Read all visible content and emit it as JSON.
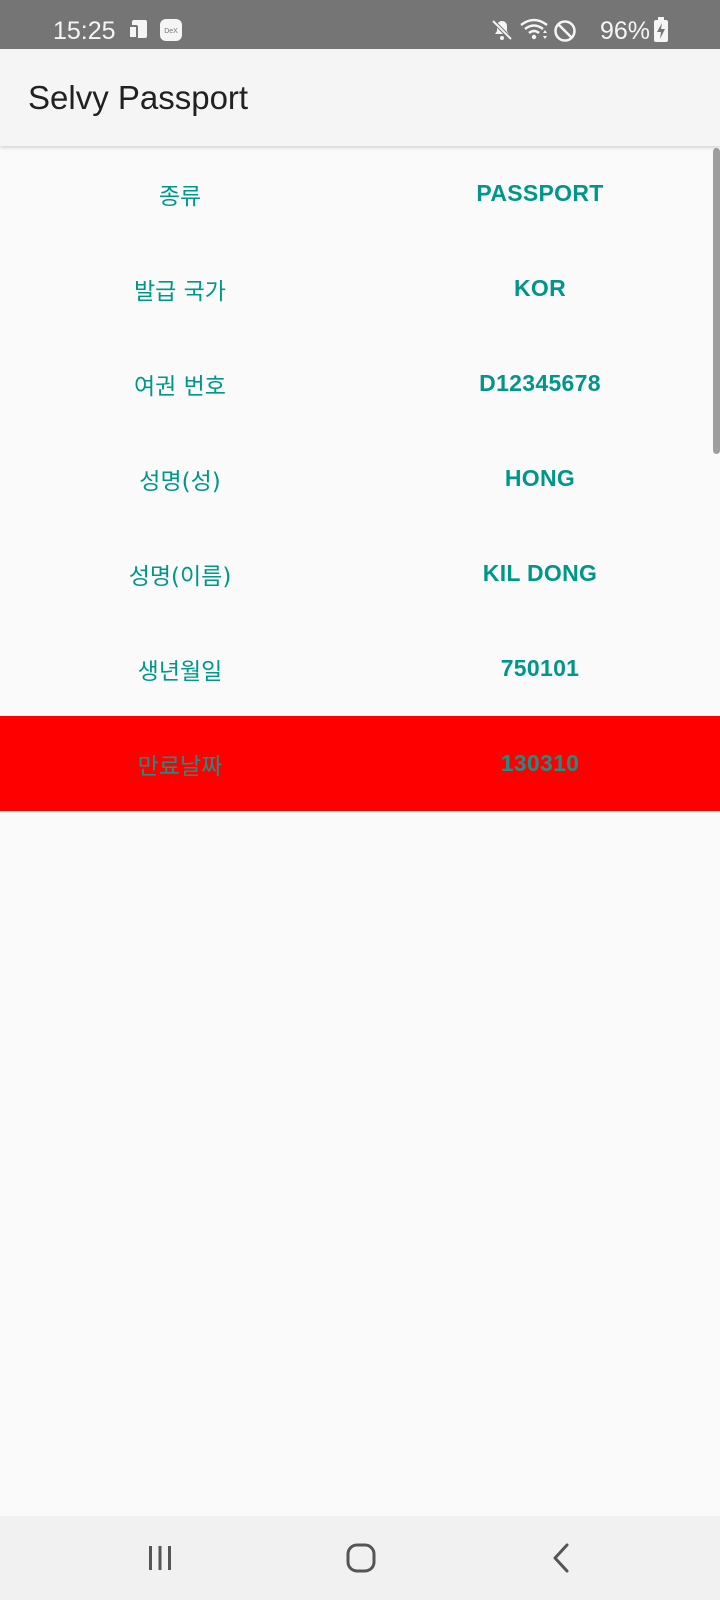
{
  "status_bar": {
    "time": "15:25",
    "battery": "96%",
    "icons": [
      "sim-icon",
      "dex-icon",
      "mute-icon",
      "wifi-icon",
      "do-not-disturb-icon",
      "battery-charging-icon"
    ],
    "dex_label": "DeX"
  },
  "app_bar": {
    "title": "Selvy Passport"
  },
  "fields": [
    {
      "label": "종류",
      "value": "PASSPORT"
    },
    {
      "label": "발급 국가",
      "value": "KOR"
    },
    {
      "label": "여권 번호",
      "value": "D12345678"
    },
    {
      "label": "성명(성)",
      "value": "HONG"
    },
    {
      "label": "성명(이름)",
      "value": "KIL DONG"
    },
    {
      "label": "생년월일",
      "value": "750101"
    },
    {
      "label": "만료날짜",
      "value": "130310",
      "highlight": true
    }
  ],
  "colors": {
    "accent_text": "#009688",
    "expired_highlight": "#ff0000",
    "status_bar": "#757575",
    "app_bar": "#f5f5f5",
    "background": "#fafafa"
  },
  "nav_bar": {
    "buttons": [
      "recent-apps-icon",
      "home-icon",
      "back-icon"
    ]
  }
}
